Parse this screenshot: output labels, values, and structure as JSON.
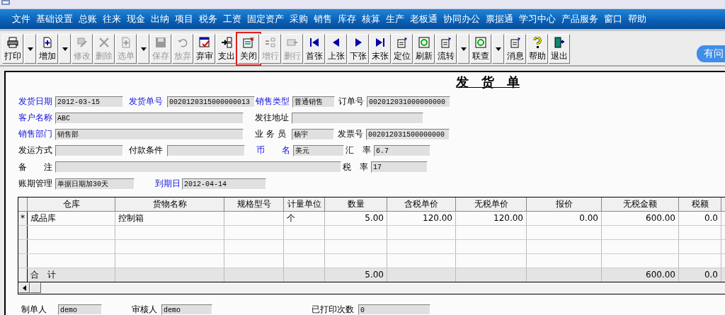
{
  "menu": [
    "文件",
    "基础设置",
    "总账",
    "往来",
    "现金",
    "出纳",
    "项目",
    "税务",
    "工资",
    "固定资产",
    "采购",
    "销售",
    "库存",
    "核算",
    "生产",
    "老板通",
    "协同办公",
    "票据通",
    "学习中心",
    "产品服务",
    "窗口",
    "帮助"
  ],
  "toolbar": [
    {
      "label": "打印",
      "disabled": false,
      "dropdown": true,
      "highlighted": false
    },
    {
      "label": "增加",
      "disabled": false,
      "dropdown": true,
      "highlighted": false
    },
    {
      "label": "修改",
      "disabled": true,
      "dropdown": false,
      "highlighted": false
    },
    {
      "label": "删除",
      "disabled": true,
      "dropdown": false,
      "highlighted": false
    },
    {
      "label": "选单",
      "disabled": true,
      "dropdown": true,
      "highlighted": false
    },
    {
      "label": "保存",
      "disabled": true,
      "dropdown": false,
      "highlighted": false
    },
    {
      "label": "放弃",
      "disabled": true,
      "dropdown": false,
      "highlighted": false
    },
    {
      "label": "弃审",
      "disabled": false,
      "dropdown": false,
      "highlighted": false
    },
    {
      "label": "支出",
      "disabled": false,
      "dropdown": false,
      "highlighted": false
    },
    {
      "label": "关闭",
      "disabled": false,
      "dropdown": false,
      "highlighted": true
    },
    {
      "label": "增行",
      "disabled": true,
      "dropdown": false,
      "highlighted": false
    },
    {
      "label": "删行",
      "disabled": true,
      "dropdown": false,
      "highlighted": false
    },
    {
      "label": "首张",
      "disabled": false,
      "dropdown": false,
      "highlighted": false
    },
    {
      "label": "上张",
      "disabled": false,
      "dropdown": false,
      "highlighted": false
    },
    {
      "label": "下张",
      "disabled": false,
      "dropdown": false,
      "highlighted": false
    },
    {
      "label": "末张",
      "disabled": false,
      "dropdown": false,
      "highlighted": false
    },
    {
      "label": "定位",
      "disabled": false,
      "dropdown": false,
      "highlighted": false
    },
    {
      "label": "刷新",
      "disabled": false,
      "dropdown": false,
      "highlighted": false
    },
    {
      "label": "流转",
      "disabled": false,
      "dropdown": true,
      "highlighted": false
    },
    {
      "label": "联查",
      "disabled": false,
      "dropdown": true,
      "highlighted": false
    },
    {
      "label": "消息",
      "disabled": false,
      "dropdown": false,
      "highlighted": false
    },
    {
      "label": "帮助",
      "disabled": false,
      "dropdown": false,
      "highlighted": false
    },
    {
      "label": "退出",
      "disabled": false,
      "dropdown": false,
      "highlighted": false
    }
  ],
  "help_pill": "有问",
  "form": {
    "title": "发　货　单",
    "fields": [
      {
        "label": "发货日期",
        "value": "2012-03-15",
        "required": true
      },
      {
        "label": "发货单号",
        "value": "0020120315000000013",
        "required": true
      },
      {
        "label": "销售类型",
        "value": "普通销售",
        "required": true
      },
      {
        "label": "订单号",
        "value": "002012031000000000",
        "required": false
      },
      {
        "label": "客户名称",
        "value": "ABC",
        "required": true
      },
      {
        "label": "发往地址",
        "required": false
      },
      {
        "label": "销售部门",
        "value": "销售部",
        "required": true
      },
      {
        "label": "业 务 员",
        "value": "杨宇",
        "required": false
      },
      {
        "label": "发票号",
        "value": "002012031500000000",
        "required": false
      },
      {
        "label": "发运方式",
        "required": false
      },
      {
        "label": "付款条件",
        "required": false
      },
      {
        "label": "币　　名",
        "value": "美元",
        "required": true
      },
      {
        "label": "汇　率",
        "value": "6.7",
        "required": false
      },
      {
        "label": "备　　注",
        "required": false
      },
      {
        "label": "税　率",
        "value": "17",
        "required": false
      },
      {
        "label": "账期管理",
        "value": "单据日期加30天",
        "required": false
      },
      {
        "label": "到期日",
        "value": "2012-04-14",
        "required": true
      }
    ]
  },
  "table": {
    "columns": [
      "仓库",
      "货物名称",
      "规格型号",
      "计量单位",
      "数量",
      "含税单价",
      "无税单价",
      "报价",
      "无税金额",
      "税额"
    ],
    "rows": [
      {
        "marker": "*",
        "cells": [
          "成品库",
          "控制箱",
          "",
          "个",
          "5.00",
          "120.00",
          "120.00",
          "0.00",
          "600.00",
          "0.0"
        ]
      },
      {
        "cells": [
          "",
          "",
          "",
          "",
          "",
          "",
          "",
          "",
          "",
          ""
        ]
      },
      {
        "cells": [
          "",
          "",
          "",
          "",
          "",
          "",
          "",
          "",
          "",
          ""
        ]
      },
      {
        "cells": [
          "",
          "",
          "",
          "",
          "",
          "",
          "",
          "",
          "",
          ""
        ]
      }
    ],
    "total": {
      "label": "合　计",
      "cells": [
        "",
        "",
        "",
        "",
        "5.00",
        "",
        "",
        "",
        "600.00",
        "0.0"
      ]
    }
  },
  "footer": [
    {
      "label": "制单人",
      "value": "demo"
    },
    {
      "label": "审核人",
      "value": "demo"
    },
    {
      "label": "已打印次数",
      "value": "0"
    }
  ]
}
